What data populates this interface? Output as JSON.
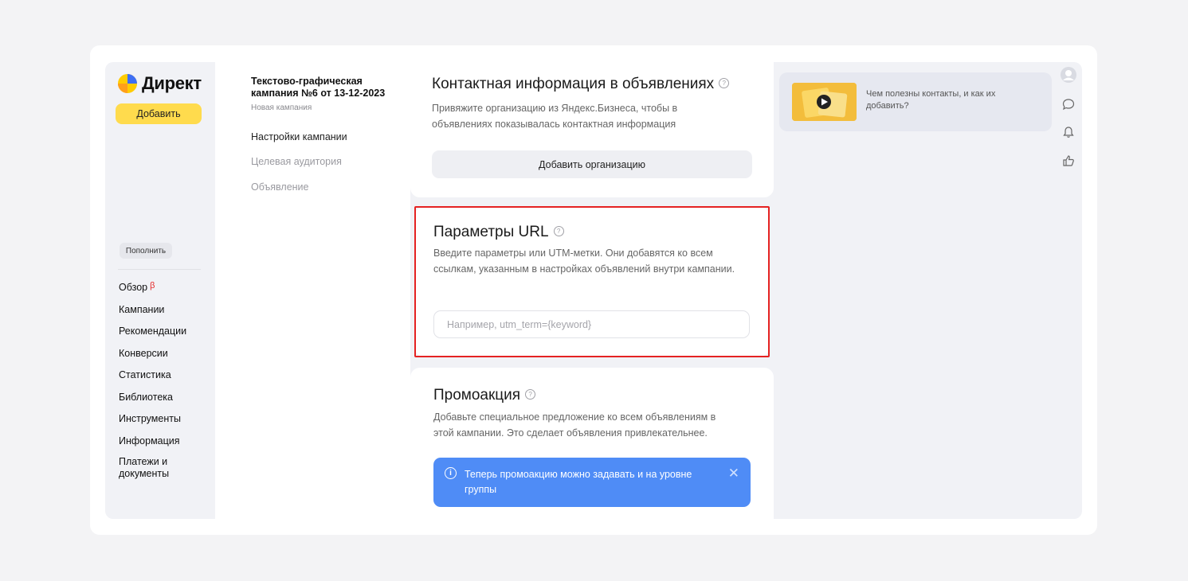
{
  "app": {
    "logo_text": "Директ",
    "add_label": "Добавить",
    "topup_label": "Пополнить"
  },
  "nav": [
    {
      "label": "Обзор",
      "badge": "β"
    },
    {
      "label": "Кампании"
    },
    {
      "label": "Рекомендации"
    },
    {
      "label": "Конверсии"
    },
    {
      "label": "Статистика"
    },
    {
      "label": "Библиотека"
    },
    {
      "label": "Инструменты"
    },
    {
      "label": "Информация"
    },
    {
      "label": "Платежи и документы"
    }
  ],
  "campaign": {
    "title": "Текстово-графическая кампания №6 от 13-12-2023",
    "subtitle": "Новая кампания",
    "steps": [
      {
        "label": "Настройки кампании",
        "active": true
      },
      {
        "label": "Целевая аудитория",
        "active": false
      },
      {
        "label": "Объявление",
        "active": false
      }
    ]
  },
  "contact_card": {
    "title": "Контактная информация в объявлениях",
    "description": "Привяжите организацию из Яндекс.Бизнеса, чтобы в объявлениях показывалась контактная информация",
    "button_label": "Добавить организацию"
  },
  "url_params_card": {
    "title": "Параметры URL",
    "description": "Введите параметры или UTM-метки. Они добавятся ко всем ссылкам, указанным в настройках объявлений внутри кампании.",
    "input_value": "",
    "input_placeholder": "Например, utm_term={keyword}"
  },
  "promo_card": {
    "title": "Промоакция",
    "description": "Добавьте специальное предложение ко всем объявлениям в этой кампании. Это сделает объявления привлекательнее.",
    "banner_text": "Теперь промоакцию можно задавать и на уровне группы"
  },
  "help_video": {
    "text": "Чем полезны контакты, и как их добавить?"
  },
  "icons": {
    "help": "?",
    "info": "i",
    "close": "✕"
  },
  "colors": {
    "accent_yellow": "#ffdb4d",
    "banner_blue": "#4f8cf6",
    "highlight_red": "#e52222"
  }
}
